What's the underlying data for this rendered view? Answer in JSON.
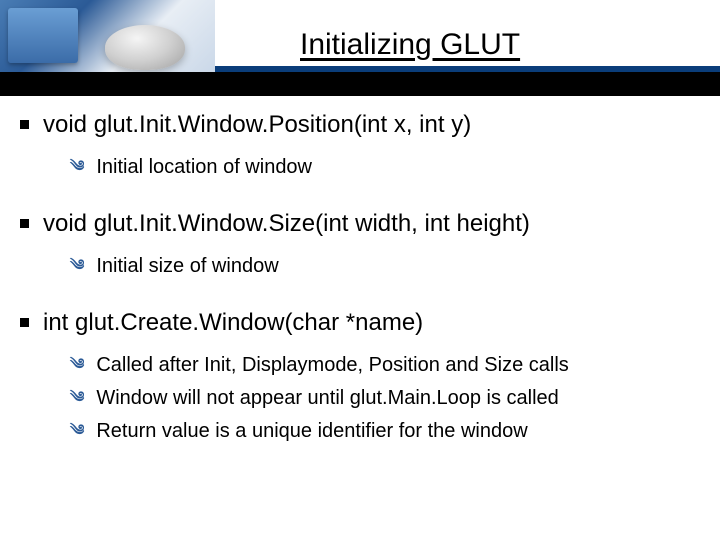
{
  "title": "Initializing GLUT",
  "sections": [
    {
      "heading": "void glut.Init.Window.Position(int x, int y)",
      "items": [
        "Initial location of window"
      ]
    },
    {
      "heading": "void glut.Init.Window.Size(int width, int height)",
      "items": [
        "Initial size of window"
      ]
    },
    {
      "heading": "int glut.Create.Window(char *name)",
      "items": [
        "Called after Init, Displaymode, Position and Size calls",
        "Window will not appear until glut.Main.Loop is called",
        "Return value is a unique identifier for the window"
      ]
    }
  ]
}
